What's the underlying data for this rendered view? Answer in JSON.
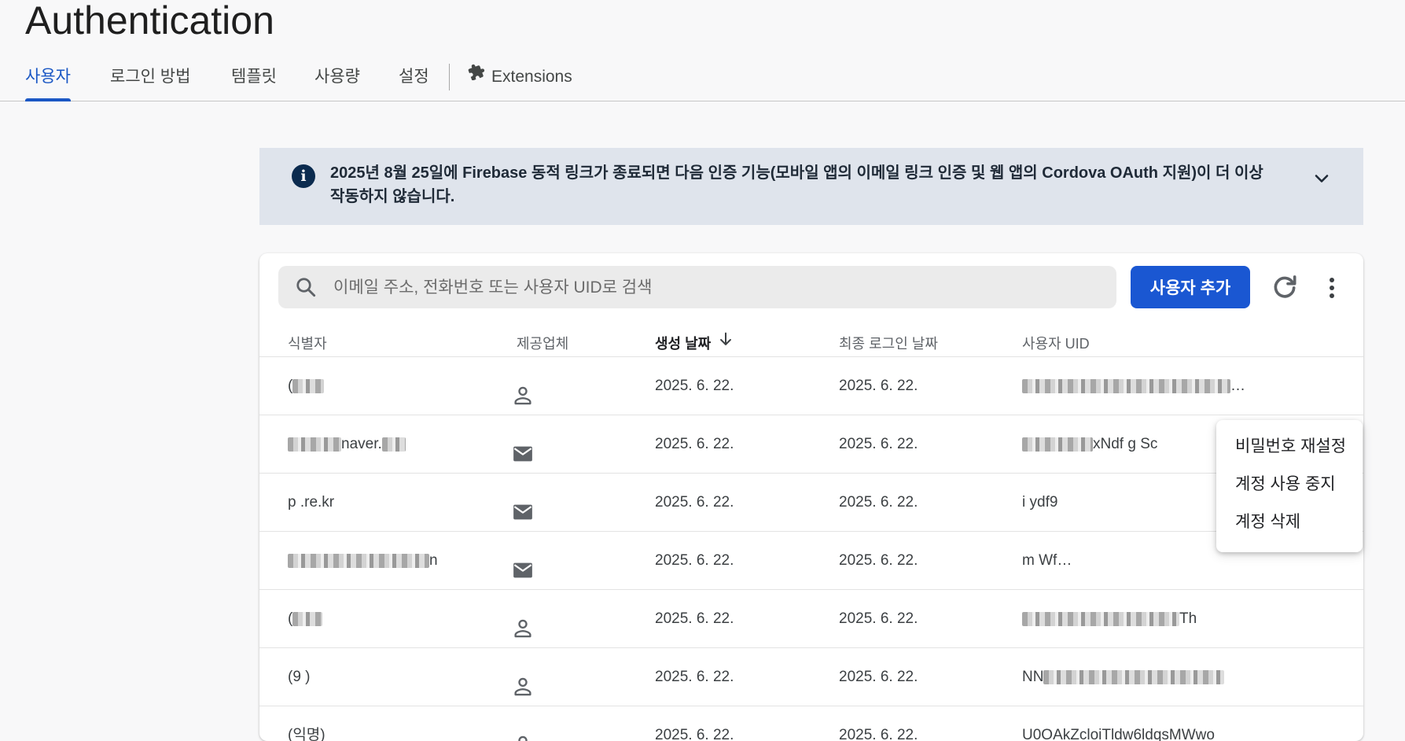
{
  "page": {
    "title": "Authentication"
  },
  "tabs": [
    {
      "label": "사용자",
      "active": true
    },
    {
      "label": "로그인 방법",
      "active": false
    },
    {
      "label": "템플릿",
      "active": false
    },
    {
      "label": "사용량",
      "active": false
    },
    {
      "label": "설정",
      "active": false
    },
    {
      "label": "Extensions",
      "active": false,
      "icon": "puzzle-icon"
    }
  ],
  "banner": {
    "icon": "info-icon",
    "text": "2025년 8월 25일에 Firebase 동적 링크가 종료되면 다음 인증 기능(모바일 앱의 이메일 링크 인증 및 웹 앱의 Cordova OAuth 지원)이 더 이상 작동하지 않습니다.",
    "expand_icon": "chevron-down-icon"
  },
  "users_panel": {
    "search_placeholder": "이메일 주소, 전화번호 또는 사용자 UID로 검색",
    "search_value": "",
    "add_user_label": "사용자 추가",
    "columns": {
      "identifier": "식별자",
      "provider": "제공업체",
      "created": "생성 날짜",
      "last_sign_in": "최종 로그인 날짜",
      "uid": "사용자 UID"
    },
    "sort_column": "created",
    "sort_direction": "descending",
    "rows": [
      {
        "identifier_visible": "(",
        "provider_icon": "person-icon",
        "created": "2025. 6. 22.",
        "last_sign_in": "2025. 6. 22.",
        "uid_visible": "…"
      },
      {
        "identifier_visible": "naver.",
        "provider_icon": "email-icon",
        "created": "2025. 6. 22.",
        "last_sign_in": "2025. 6. 22.",
        "uid_visible": "xNdf  g    Sc"
      },
      {
        "identifier_visible": "p      .re.kr",
        "provider_icon": "email-icon",
        "created": "2025. 6. 22.",
        "last_sign_in": "2025. 6. 22.",
        "uid_visible": "i       ydf9"
      },
      {
        "identifier_visible": "n",
        "provider_icon": "email-icon",
        "created": "2025. 6. 22.",
        "last_sign_in": "2025. 6. 22.",
        "uid_visible": "m       Wf…"
      },
      {
        "identifier_visible": "(",
        "provider_icon": "person-icon",
        "created": "2025. 6. 22.",
        "last_sign_in": "2025. 6. 22.",
        "uid_visible": "Th"
      },
      {
        "identifier_visible": "(9   )",
        "provider_icon": "person-icon",
        "created": "2025. 6. 22.",
        "last_sign_in": "2025. 6. 22.",
        "uid_visible": "NN"
      },
      {
        "identifier_visible": "(익명)",
        "provider_icon": "person-icon",
        "created": "2025. 6. 22.",
        "last_sign_in": "2025. 6. 22.",
        "uid_visible": "U0OAkZcloiTldw6ldqsMWwo"
      }
    ]
  },
  "context_menu": {
    "items": [
      "비밀번호 재설정",
      "계정 사용 중지",
      "계정 삭제"
    ]
  },
  "colors": {
    "accent": "#1a57c4",
    "button": "#1a57d2",
    "banner_bg": "#dfe4ec",
    "background": "#f8f8f9"
  }
}
